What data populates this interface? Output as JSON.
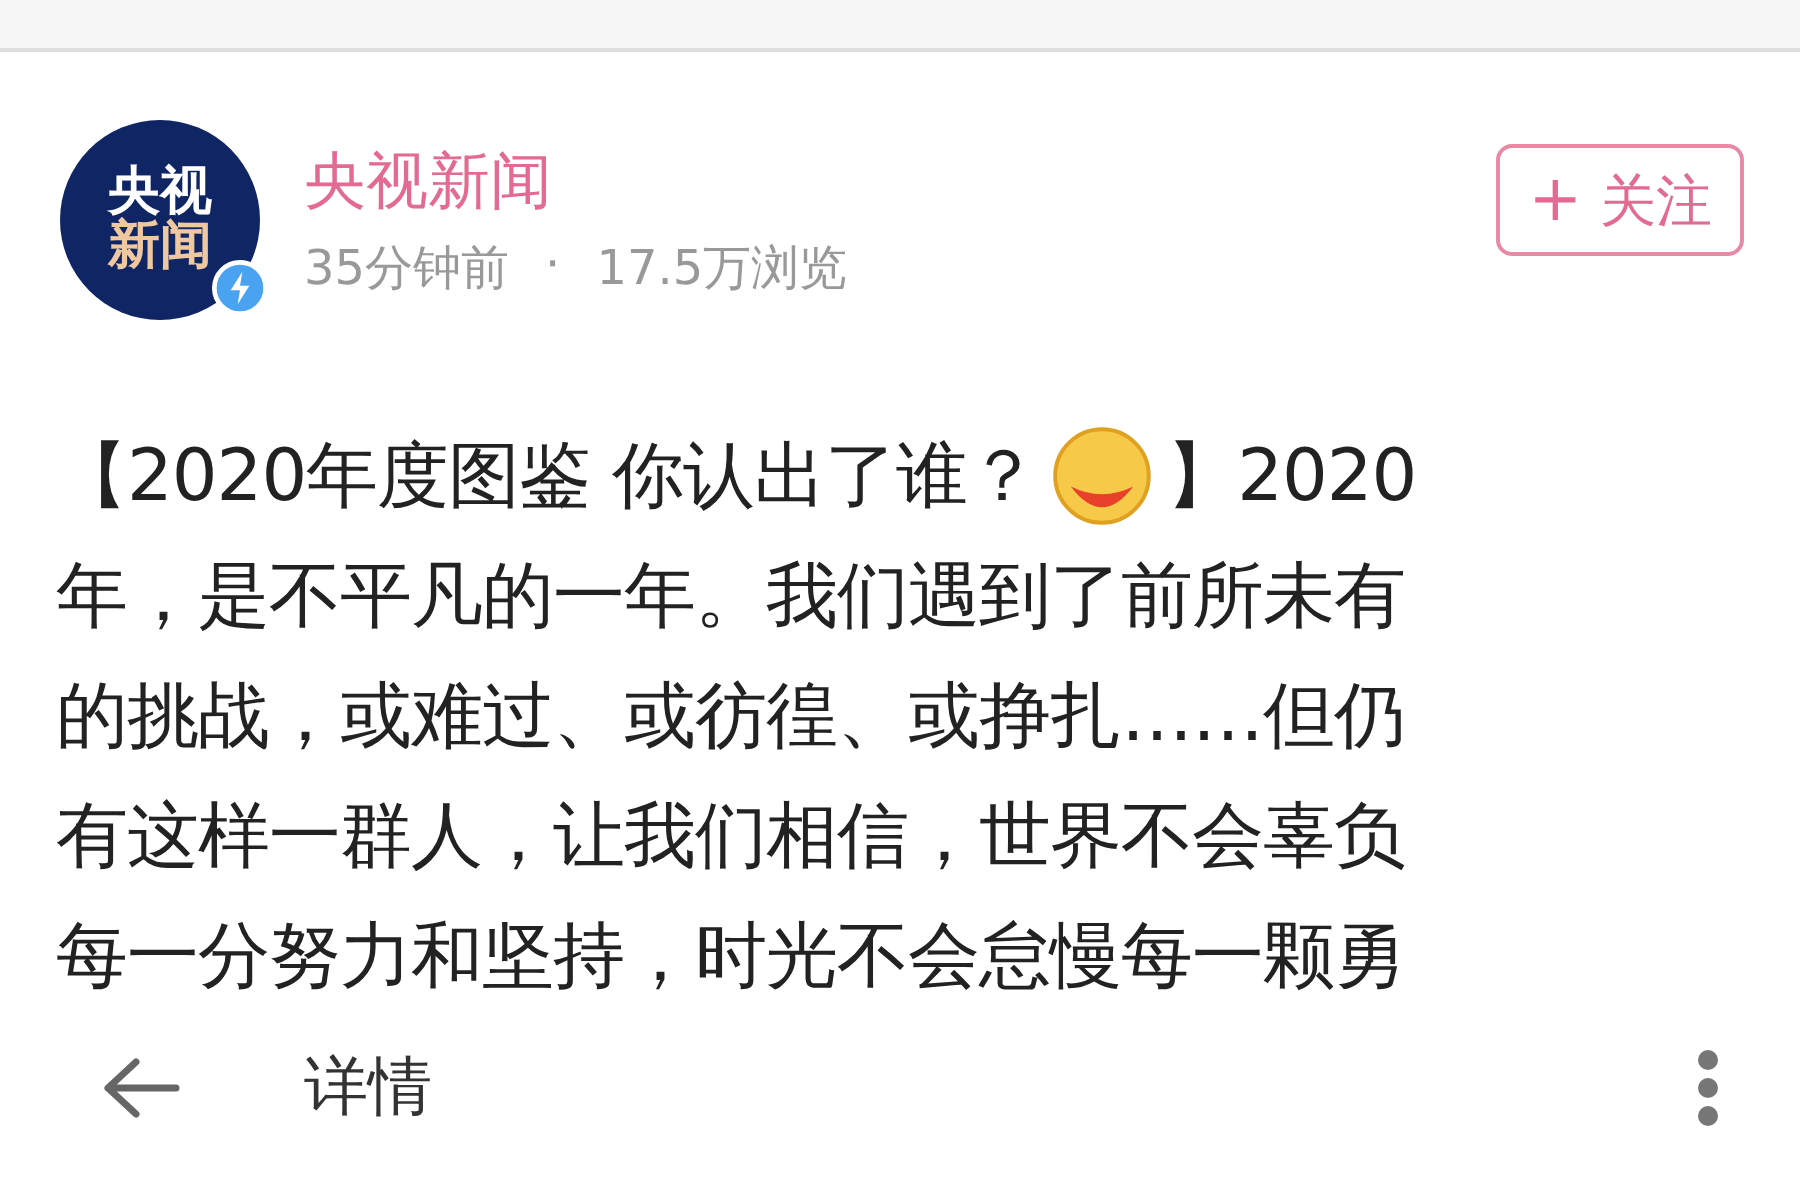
{
  "author": {
    "avatar_lines": [
      "央视",
      "新闻"
    ],
    "verified": true,
    "name": "央视新闻",
    "time": "35分钟前",
    "separator": "·",
    "views": "17.5万浏览"
  },
  "follow_button": {
    "icon": "+",
    "label": "关注"
  },
  "post": {
    "lines": [
      [
        {
          "kind": "text",
          "text": "【2020年度图鉴 你认出了谁？"
        },
        {
          "kind": "emoji"
        },
        {
          "kind": "text",
          "text": "】2020"
        }
      ],
      [
        {
          "kind": "text",
          "text": "年，是不平凡的一年。我们遇到了前所未有"
        }
      ],
      [
        {
          "kind": "text",
          "text": "的挑战，或难过、或彷徨、或挣扎……但仍"
        }
      ],
      [
        {
          "kind": "text",
          "text": "有这样一群人，让我们相信，世界不会辜负"
        }
      ],
      [
        {
          "kind": "text",
          "text": "每一分努力和坚持，时光不会怠慢每一颗勇"
        }
      ]
    ]
  },
  "bottom_bar": {
    "title": "详情"
  }
}
